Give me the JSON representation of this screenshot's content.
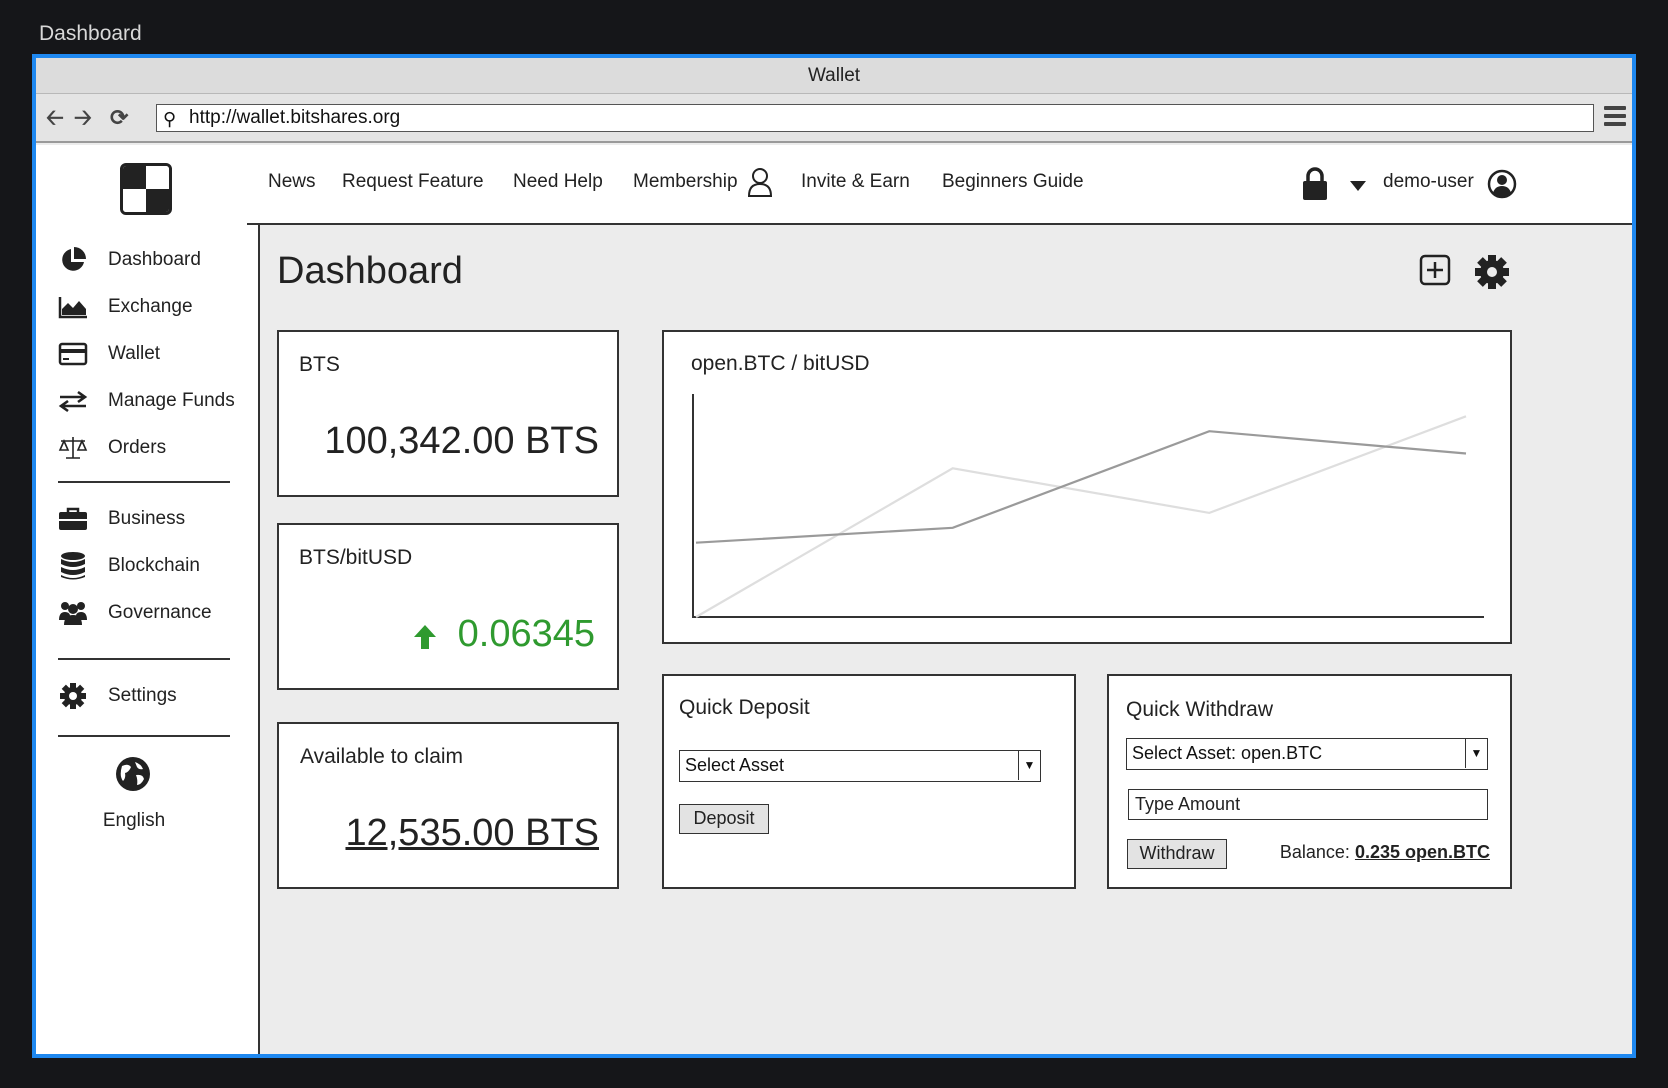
{
  "outer_title": "Dashboard",
  "window": {
    "title": "Wallet"
  },
  "browser": {
    "url": "http://wallet.bitshares.org"
  },
  "sidebar": {
    "items": [
      {
        "label": "Dashboard",
        "icon": "pie-chart-icon"
      },
      {
        "label": "Exchange",
        "icon": "area-chart-icon"
      },
      {
        "label": "Wallet",
        "icon": "credit-card-icon"
      },
      {
        "label": "Manage Funds",
        "icon": "transfer-arrows-icon"
      },
      {
        "label": "Orders",
        "icon": "balance-scale-icon"
      },
      {
        "label": "Business",
        "icon": "briefcase-icon"
      },
      {
        "label": "Blockchain",
        "icon": "database-icon"
      },
      {
        "label": "Governance",
        "icon": "users-icon"
      },
      {
        "label": "Settings",
        "icon": "gear-icon"
      }
    ],
    "language": "English"
  },
  "topnav": {
    "links": [
      "News",
      "Request Feature",
      "Need Help",
      "Membership",
      "Invite & Earn",
      "Beginners Guide"
    ],
    "username": "demo-user"
  },
  "main": {
    "title": "Dashboard",
    "cards": {
      "bts": {
        "label": "BTS",
        "value": "100,342.00 BTS"
      },
      "price": {
        "label": "BTS/bitUSD",
        "value": "0.06345",
        "trend": "up",
        "color": "#2f9a2f"
      },
      "claim": {
        "label": "Available to claim",
        "value": "12,535.00 BTS"
      }
    },
    "quick_deposit": {
      "title": "Quick Deposit",
      "select_value": "Select Asset",
      "button": "Deposit"
    },
    "quick_withdraw": {
      "title": "Quick Withdraw",
      "select_value": "Select Asset: open.BTC",
      "amount_placeholder": "Type Amount",
      "button": "Withdraw",
      "balance_label": "Balance:",
      "balance_value": "0.235 open.BTC"
    }
  },
  "chart_data": {
    "type": "line",
    "title": "open.BTC / bitUSD",
    "x": [
      0,
      1,
      2,
      3
    ],
    "series": [
      {
        "values": [
          0.4,
          0.6,
          1.9,
          1.6
        ],
        "color": "#9a9a9a"
      },
      {
        "values": [
          -0.6,
          1.4,
          0.8,
          2.1
        ],
        "color": "#dedede"
      }
    ],
    "ylim": [
      -0.6,
      2.4
    ],
    "grid": false
  }
}
